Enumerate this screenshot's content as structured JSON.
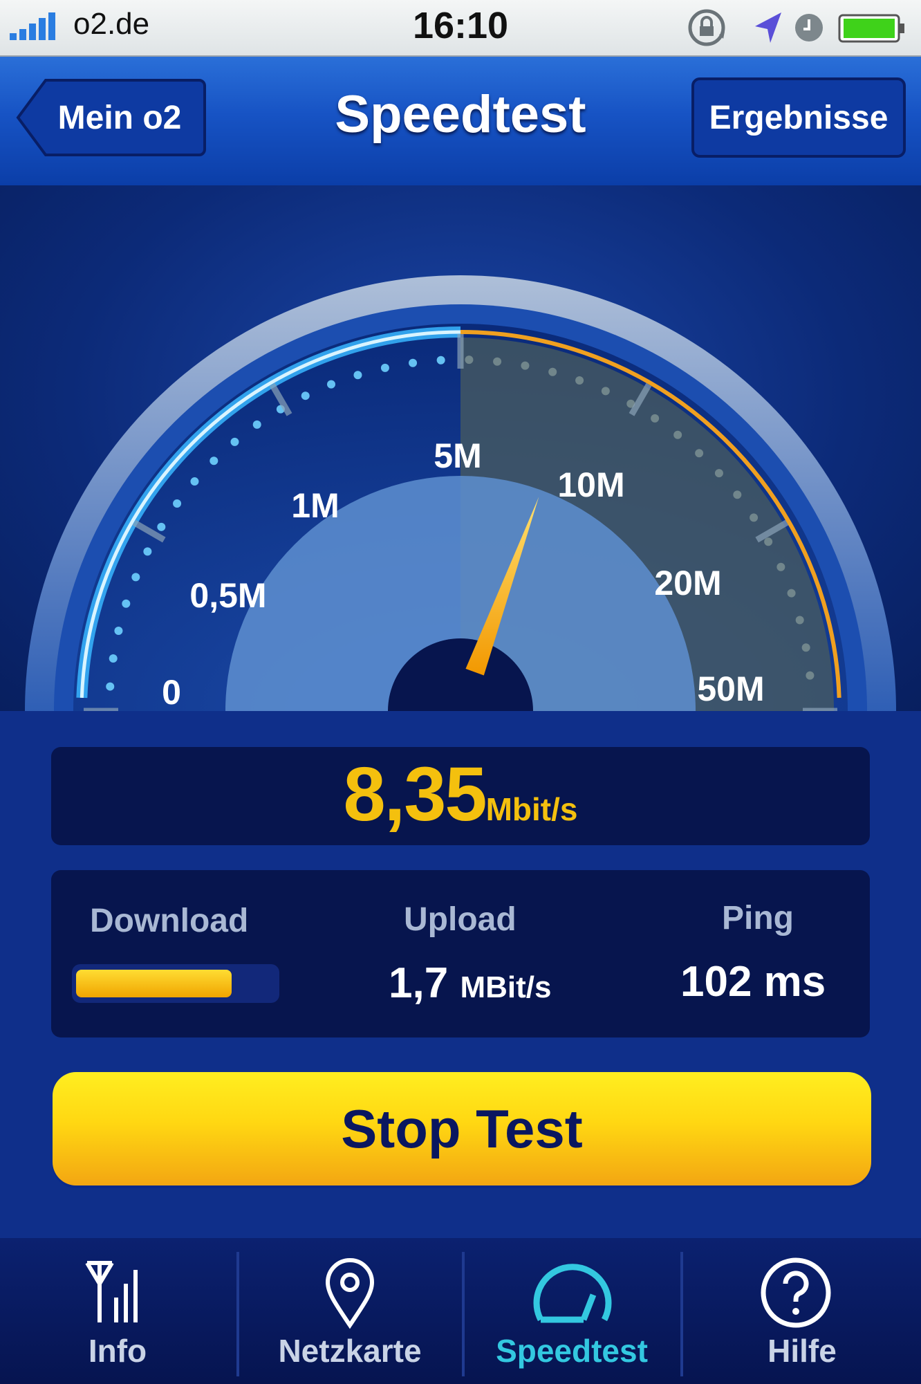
{
  "status_bar": {
    "carrier": "o2.de",
    "time": "16:10",
    "icons": [
      "signal-icon",
      "rotation-lock-icon",
      "location-arrow-icon",
      "clock-icon",
      "battery-icon"
    ]
  },
  "nav": {
    "back_label": "Mein o2",
    "title": "Speedtest",
    "right_label": "Ergebnisse"
  },
  "gauge": {
    "labels": [
      "0",
      "0,5M",
      "1M",
      "5M",
      "10M",
      "20M",
      "50M"
    ],
    "current_mbit": 8.35
  },
  "result": {
    "value": "8,35",
    "unit": "Mbit/s"
  },
  "stats": {
    "download_label": "Download",
    "download_progress": 0.78,
    "upload_label": "Upload",
    "upload_value": "1,7",
    "upload_unit": "MBit/s",
    "ping_label": "Ping",
    "ping_value": "102 ms"
  },
  "stop_button_label": "Stop Test",
  "tabs": [
    {
      "label": "Info",
      "icon": "antenna-icon",
      "active": false
    },
    {
      "label": "Netzkarte",
      "icon": "map-pin-icon",
      "active": false
    },
    {
      "label": "Speedtest",
      "icon": "speedometer-icon",
      "active": true
    },
    {
      "label": "Hilfe",
      "icon": "help-icon",
      "active": false
    }
  ],
  "colors": {
    "accent_yellow": "#f4c00e",
    "active_tab": "#33c8e0",
    "panel": "#07154e"
  }
}
